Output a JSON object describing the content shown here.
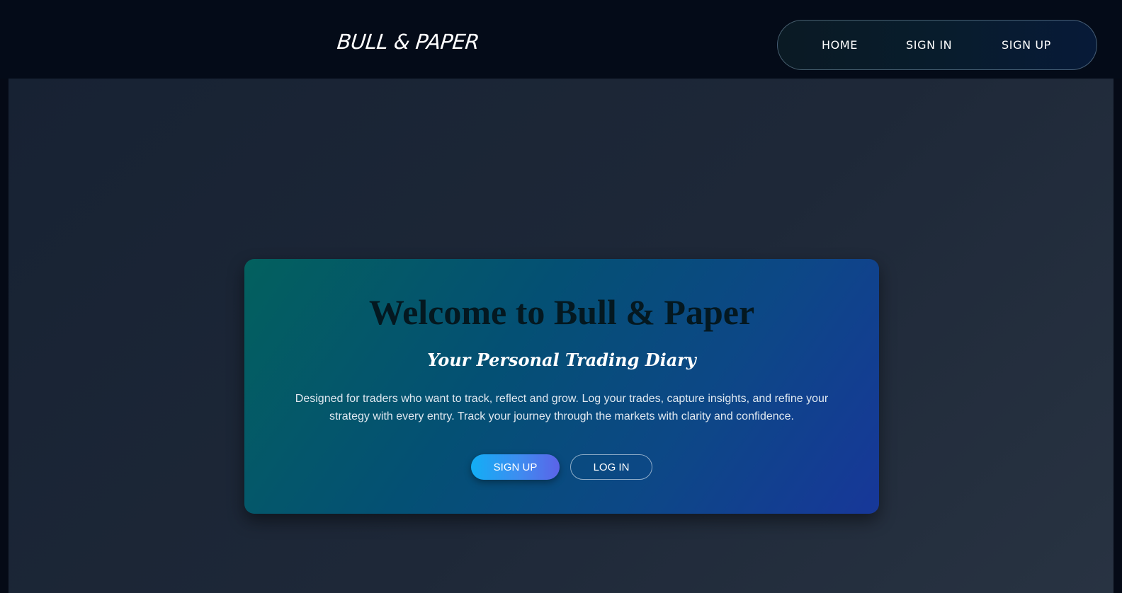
{
  "header": {
    "logo_text": "BULL & PAPER",
    "nav": {
      "home": "HOME",
      "sign_in": "SIGN IN",
      "sign_up": "SIGN UP"
    }
  },
  "hero": {
    "title": "Welcome to Bull & Paper",
    "subtitle": "Your Personal Trading Diary",
    "description": "Designed for traders who want to track, reflect and grow. Log your trades, capture insights, and refine your strategy with every entry. Track your journey through the markets with clarity and confidence.",
    "signup_button": "SIGN UP",
    "login_button": "LOG IN"
  },
  "colors": {
    "header_background": "#040b18",
    "card_gradient_start": "#03605e",
    "card_gradient_end": "#173799",
    "primary_button_start": "#12aef5",
    "primary_button_end": "#5b63e8"
  }
}
